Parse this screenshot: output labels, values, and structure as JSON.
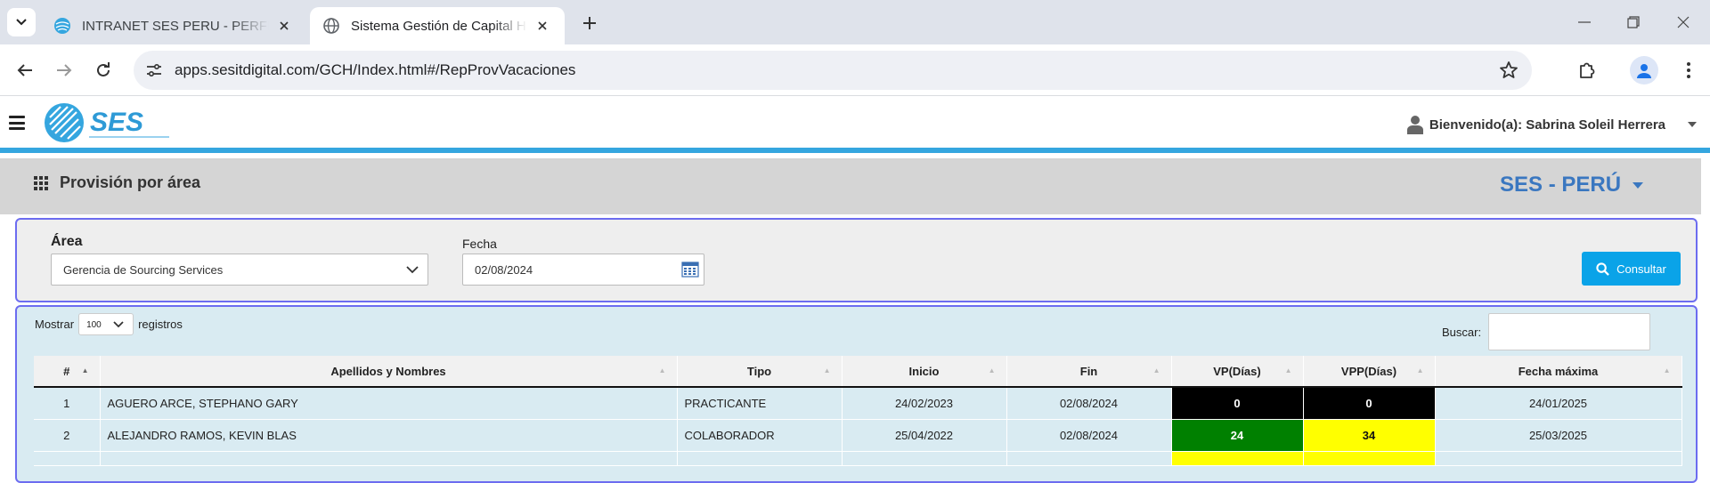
{
  "browser": {
    "tabs": [
      {
        "title": "INTRANET SES PERU - PERFIL DE",
        "active": false
      },
      {
        "title": "Sistema Gestión de Capital Hum",
        "active": true
      }
    ],
    "url": "apps.sesitdigital.com/GCH/Index.html#/RepProvVacaciones"
  },
  "header": {
    "logo_text": "SES",
    "welcome": "Bienvenido(a): Sabrina Soleil Herrera",
    "accent": "#35a6df"
  },
  "page": {
    "title": "Provisión por área",
    "company": "SES - PERÚ"
  },
  "filters": {
    "area_label": "Área",
    "area_value": "Gerencia de Sourcing Services",
    "fecha_label": "Fecha",
    "fecha_value": "02/08/2024",
    "consultar_label": "Consultar"
  },
  "table": {
    "mostrar_label": "Mostrar",
    "page_length": "100",
    "registros_label": "registros",
    "buscar_label": "Buscar:",
    "columns": [
      "#",
      "Apellidos y Nombres",
      "Tipo",
      "Inicio",
      "Fin",
      "VP(Días)",
      "VPP(Días)",
      "Fecha máxima"
    ],
    "rows": [
      {
        "n": "1",
        "nombre": "AGUERO ARCE, STEPHANO GARY",
        "tipo": "PRACTICANTE",
        "inicio": "24/02/2023",
        "fin": "02/08/2024",
        "vp": "0",
        "vpp": "0",
        "fecha_max": "24/01/2025"
      },
      {
        "n": "2",
        "nombre": "ALEJANDRO RAMOS, KEVIN BLAS",
        "tipo": "COLABORADOR",
        "inicio": "25/04/2022",
        "fin": "02/08/2024",
        "vp": "24",
        "vpp": "34",
        "fecha_max": "25/03/2025"
      }
    ],
    "status_colors": {
      "zero": "#000000",
      "ok": "#008000",
      "warn": "#ffff00"
    }
  }
}
